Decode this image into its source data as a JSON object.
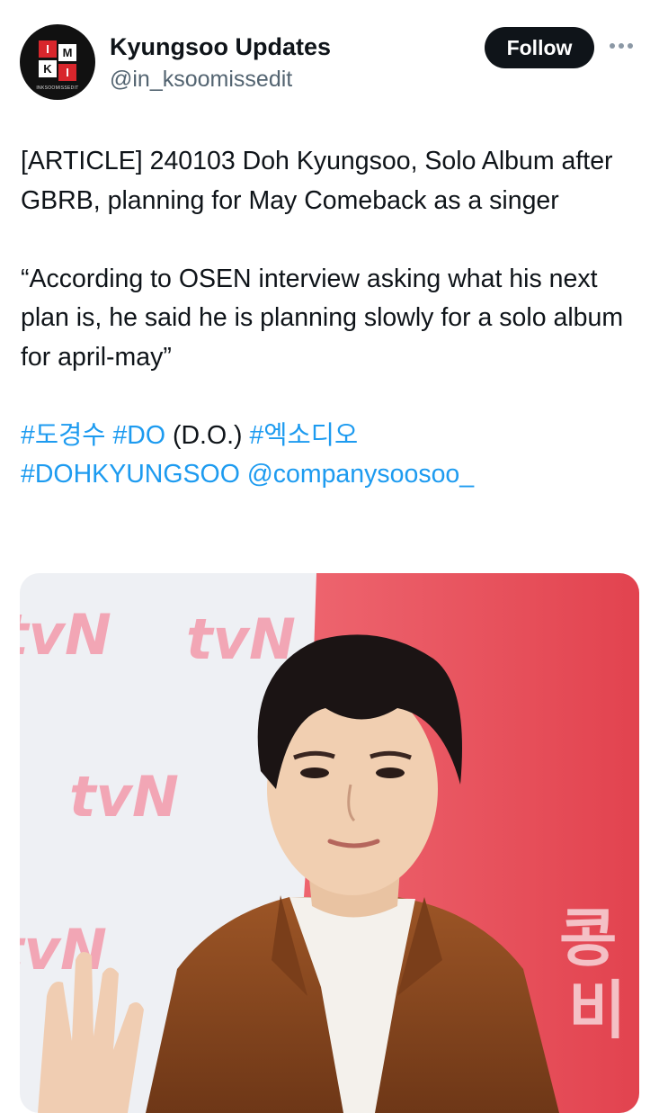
{
  "account": {
    "name": "Kyungsoo Updates",
    "handle": "@in_ksoomissedit",
    "avatar_letters": [
      "I",
      "M",
      "K",
      "I"
    ],
    "avatar_caption": "INKSOOMISSEDIT"
  },
  "actions": {
    "follow_label": "Follow",
    "more_icon": "more-horizontal-icon"
  },
  "post": {
    "line1": "[ARTICLE] 240103 Doh Kyungsoo, Solo Album after GBRB, planning for May Comeback as a singer",
    "quote": "“According to OSEN interview asking what his next plan is, he said he is planning slowly for a solo album for april-may”",
    "hashtag1": "#도경수",
    "hashtag2": "#DO",
    "paren": " (D.O.) ",
    "hashtag3": "#엑소디오",
    "hashtag4": "#DOHKYUNGSOO",
    "mention": "@companysoosoo_"
  },
  "media": {
    "backdrop_text": "tvN",
    "colors": {
      "left_bg": "#eef0f4",
      "right_bg": "#e8535f",
      "logo_pink": "#f2a6b5",
      "jacket": "#8a4a22"
    }
  }
}
